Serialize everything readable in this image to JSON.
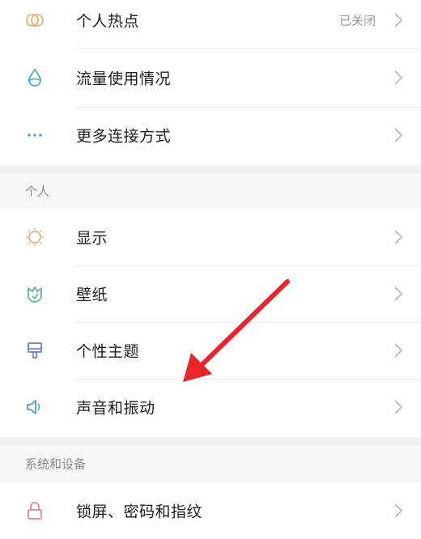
{
  "network": {
    "items": [
      {
        "label": "个人热点",
        "status": "已关闭",
        "icon": "hotspot-icon"
      },
      {
        "label": "流量使用情况",
        "icon": "data-usage-icon"
      },
      {
        "label": "更多连接方式",
        "icon": "more-connections-icon"
      }
    ]
  },
  "personal": {
    "title": "个人",
    "items": [
      {
        "label": "显示",
        "icon": "display-icon"
      },
      {
        "label": "壁纸",
        "icon": "wallpaper-icon"
      },
      {
        "label": "个性主题",
        "icon": "theme-icon"
      },
      {
        "label": "声音和振动",
        "icon": "sound-icon"
      }
    ]
  },
  "system": {
    "title": "系统和设备",
    "items": [
      {
        "label": "锁屏、密码和指纹",
        "icon": "lock-icon"
      }
    ]
  },
  "colors": {
    "annotation_arrow": "#e8262a",
    "chevron": "#b5b5b5",
    "section_bg": "#f7f7f7"
  }
}
